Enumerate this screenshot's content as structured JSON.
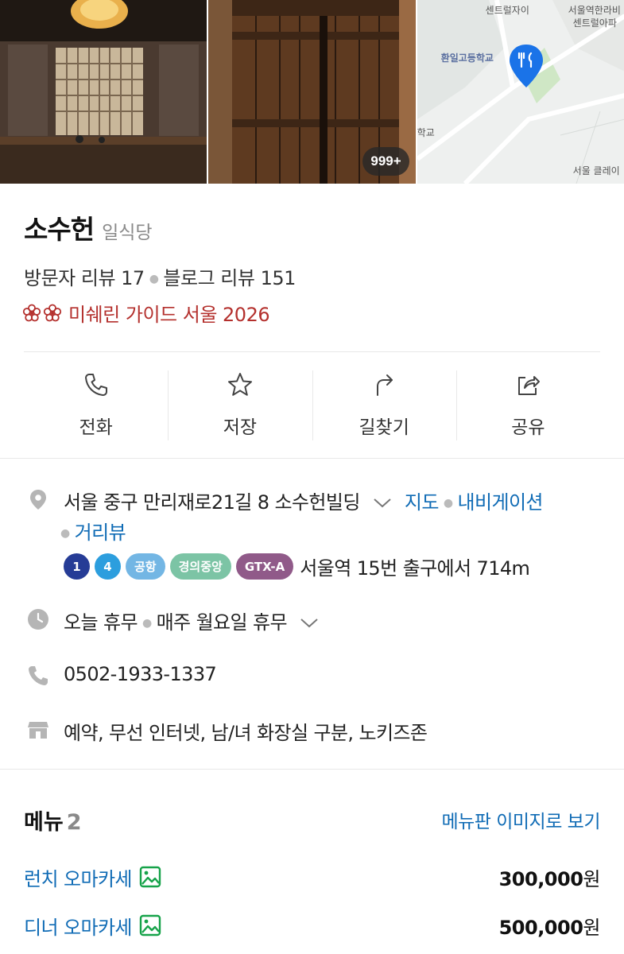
{
  "photos": {
    "count_badge": "999+"
  },
  "map": {
    "labels": [
      "센트럴자이",
      "서울역한라비",
      "센트럴아파",
      "환일고등학교",
      "학교",
      "서울 클레이"
    ]
  },
  "place": {
    "name": "소수헌",
    "category": "일식당",
    "visitor_reviews": "방문자 리뷰 17",
    "blog_reviews": "블로그 리뷰 151",
    "michelin": "미쉐린 가이드 서울 2026",
    "michelin_color": "#b4302d"
  },
  "actions": [
    {
      "label": "전화",
      "icon": "phone-icon"
    },
    {
      "label": "저장",
      "icon": "star-icon"
    },
    {
      "label": "길찾기",
      "icon": "directions-icon"
    },
    {
      "label": "공유",
      "icon": "share-icon"
    }
  ],
  "address": {
    "text": "서울 중구 만리재로21길 8 소수헌빌딩",
    "map_link": "지도",
    "navi_link": "내비게이션",
    "street_link": "거리뷰"
  },
  "subway": {
    "lines": [
      {
        "label": "1",
        "color": "#263c96"
      },
      {
        "label": "4",
        "color": "#2c9ede"
      },
      {
        "label": "공항",
        "color": "#73b6e4"
      },
      {
        "label": "경의중앙",
        "color": "#7cc4a5"
      },
      {
        "label": "GTX-A",
        "color": "#905a89"
      }
    ],
    "walk": "서울역 15번 출구에서 714m"
  },
  "hours": {
    "today": "오늘 휴무",
    "detail": "매주 월요일 휴무"
  },
  "phone": "0502-1933-1337",
  "amenities": "예약, 무선 인터넷, 남/녀 화장실 구분, 노키즈존",
  "menu": {
    "title": "메뉴",
    "count": "2",
    "image_link": "메뉴판 이미지로 보기",
    "items": [
      {
        "name": "런치 오마카세",
        "price": "300,000",
        "unit": "원"
      },
      {
        "name": "디너 오마카세",
        "price": "500,000",
        "unit": "원"
      }
    ]
  },
  "colors": {
    "link": "#0f6bb5",
    "accent_map_pin": "#1a73e8"
  }
}
